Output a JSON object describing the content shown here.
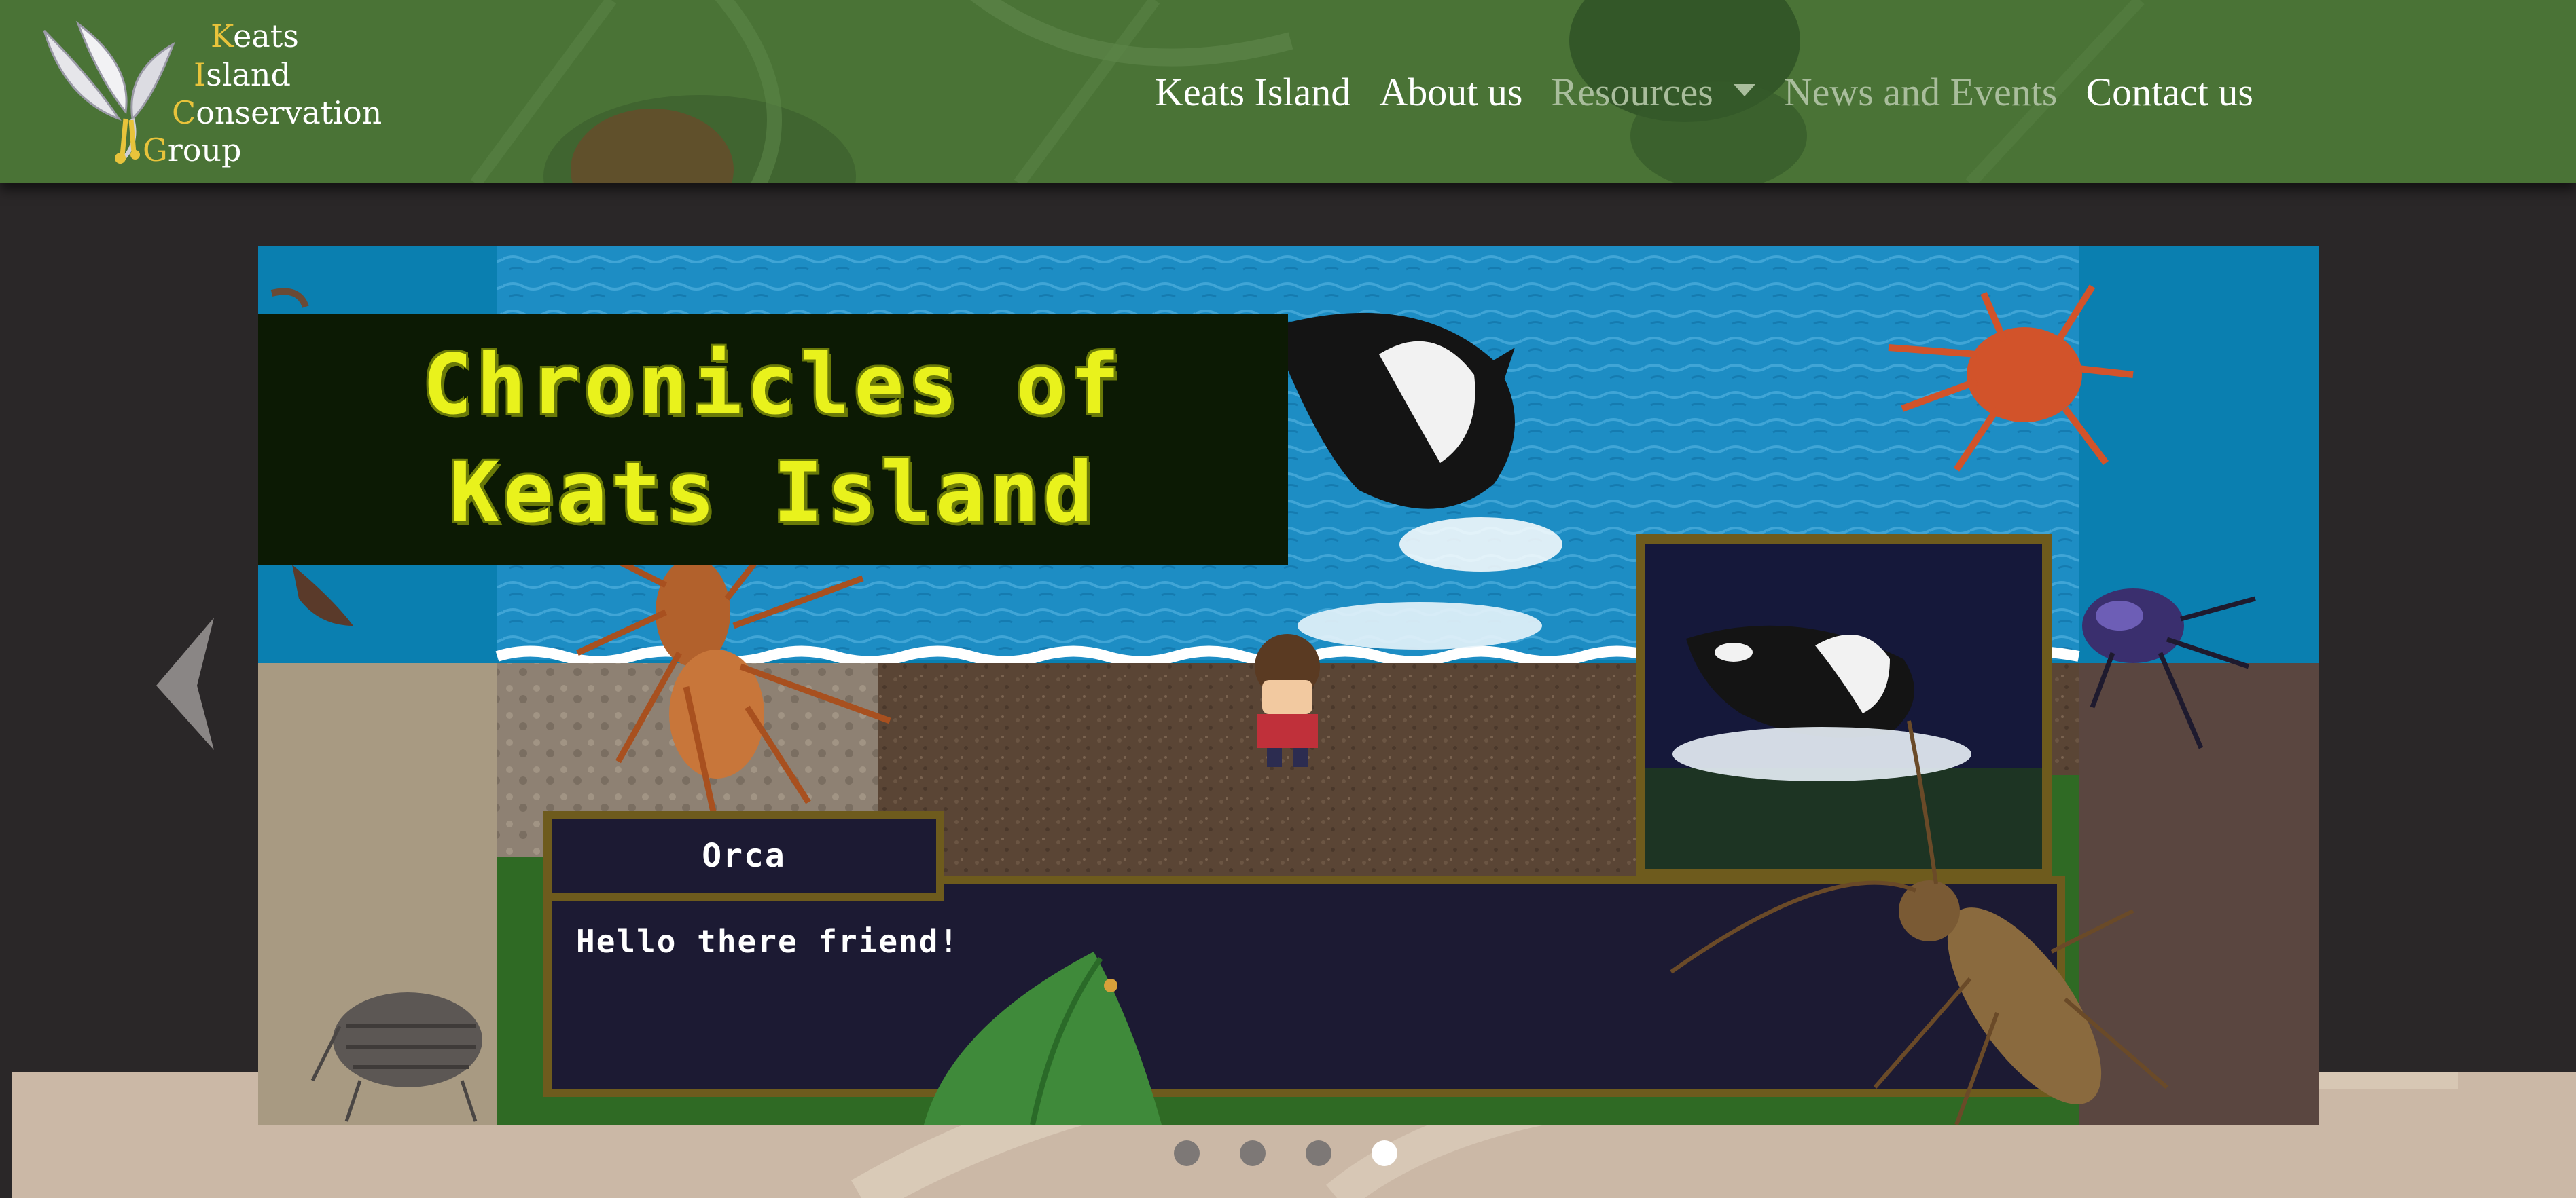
{
  "brand": {
    "logo_lines": [
      {
        "initial": "K",
        "rest": "eats"
      },
      {
        "initial": "I",
        "rest": "sland"
      },
      {
        "initial": "C",
        "rest": "onservation"
      },
      {
        "initial": "G",
        "rest": "roup"
      }
    ]
  },
  "nav": {
    "items": [
      {
        "label": "Keats Island"
      },
      {
        "label": "About us"
      },
      {
        "label": "Resources"
      },
      {
        "label": "News and Events"
      },
      {
        "label": "Contact us"
      }
    ]
  },
  "carousel": {
    "title_lines": [
      "Chronicles of",
      "Keats Island"
    ],
    "speaker_name": "Orca",
    "dialog": "Hello there friend!",
    "slide_count": 4,
    "active_slide": 4
  },
  "colors": {
    "navbar": "#4a7336",
    "page_bg": "#2a2728",
    "title_text": "#e9f21c",
    "dialog_border": "#6e5b1d"
  }
}
